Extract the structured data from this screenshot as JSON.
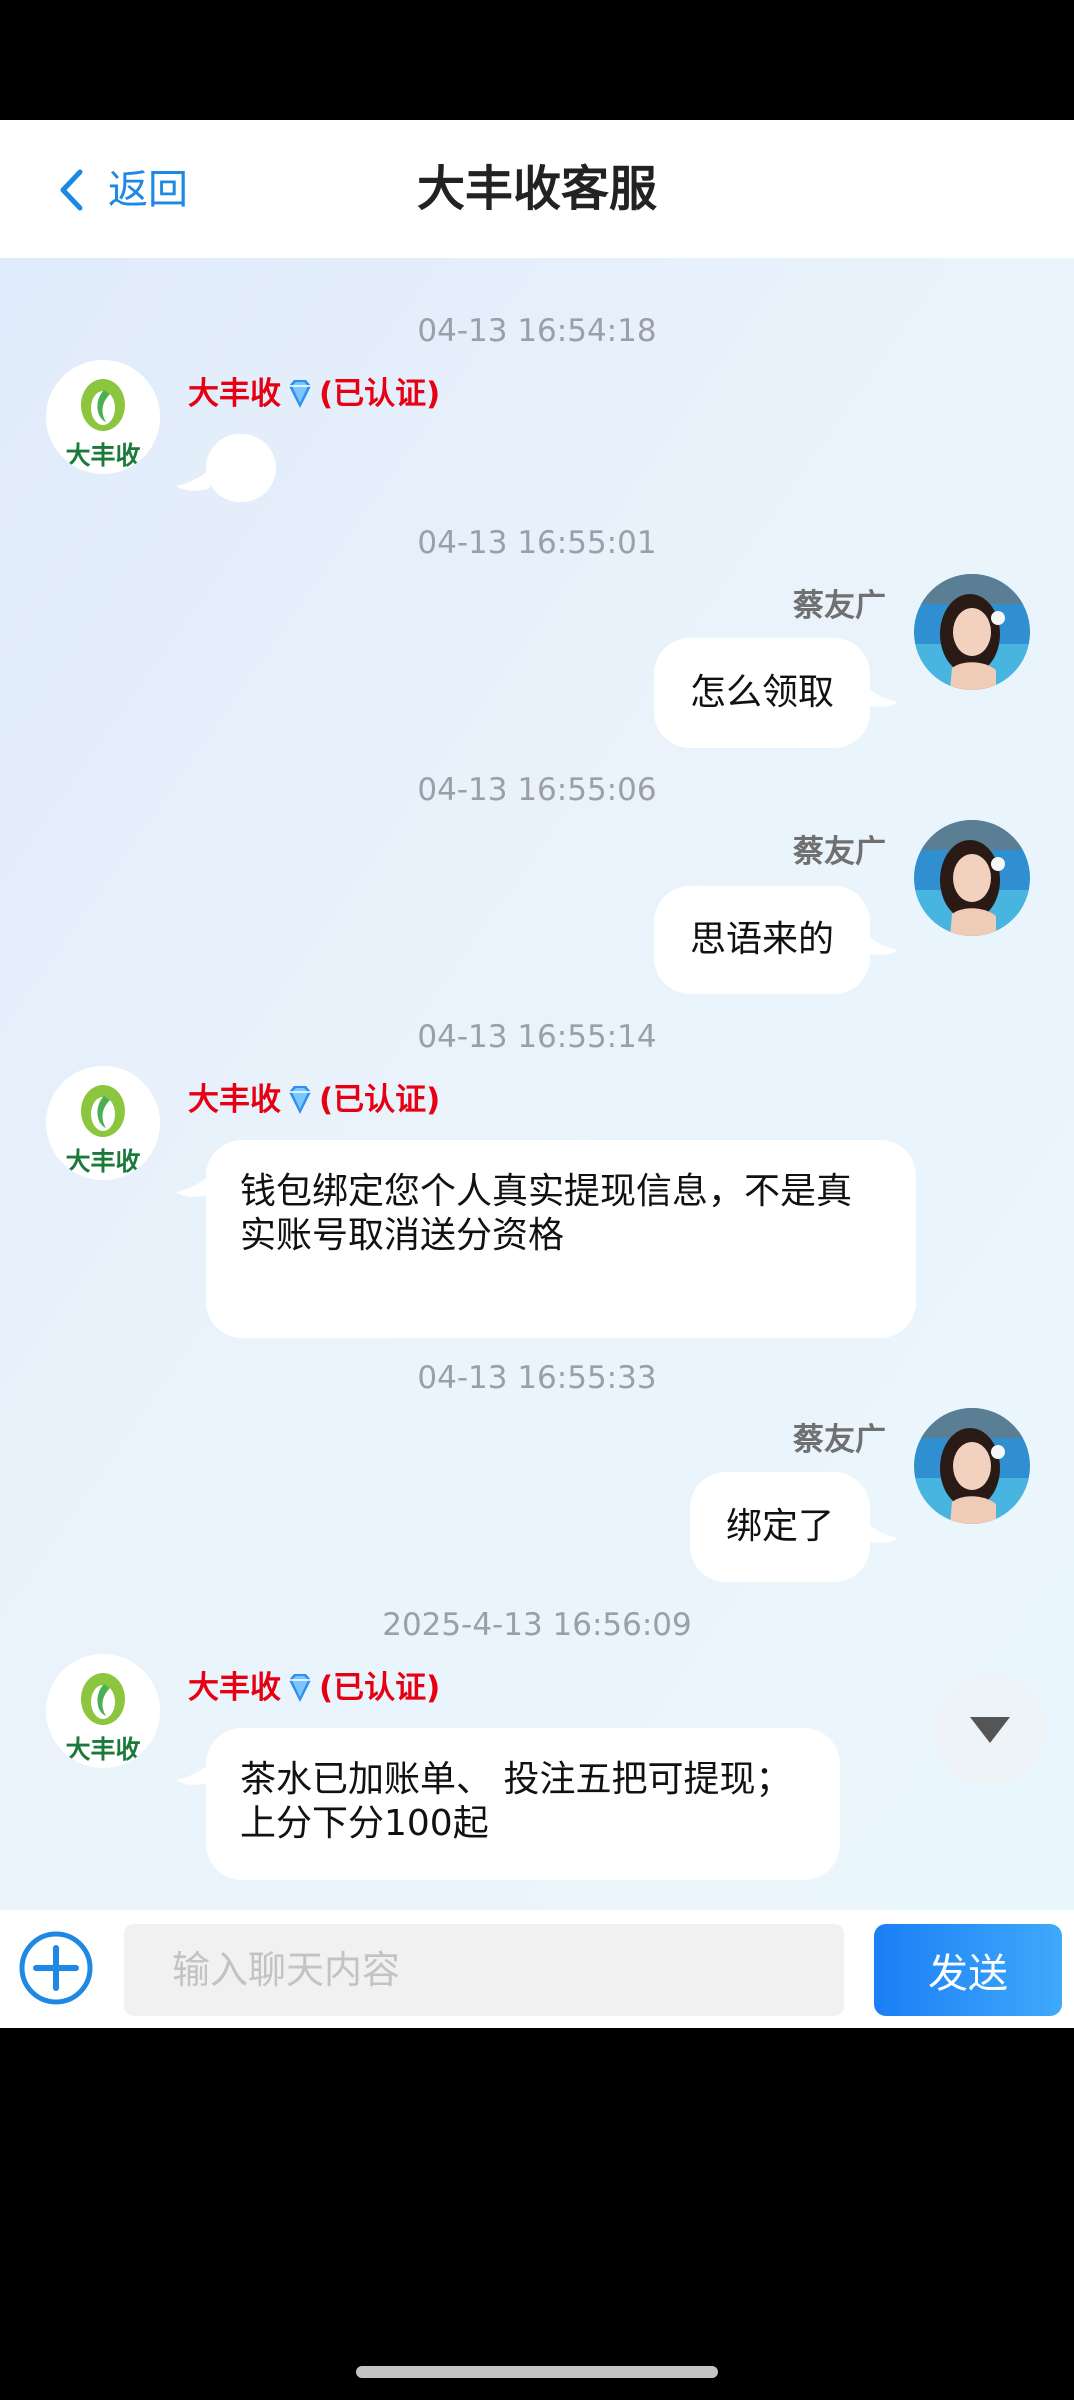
{
  "header": {
    "back_label": "返回",
    "title": "大丰收客服"
  },
  "bot": {
    "name": "大丰收",
    "verified": "(已认证)",
    "logo_text": "大丰收"
  },
  "user": {
    "name": "蔡友广"
  },
  "messages": [
    {
      "time": "04-13 16:54:18",
      "sender": "bot",
      "text": ""
    },
    {
      "time": "04-13 16:55:01",
      "sender": "user",
      "text": "怎么领取"
    },
    {
      "time": "04-13 16:55:06",
      "sender": "user",
      "text": "思语来的"
    },
    {
      "time": "04-13 16:55:14",
      "sender": "bot",
      "text": "钱包绑定您个人真实提现信息，不是真实账号取消送分资格"
    },
    {
      "time": "04-13 16:55:33",
      "sender": "user",
      "text": "绑定了"
    },
    {
      "time": "2025-4-13 16:56:09",
      "sender": "bot",
      "text": "茶水已加账单、 投注五把可提现；上分下分100起"
    }
  ],
  "input": {
    "placeholder": "输入聊天内容",
    "value": "",
    "send_label": "发送"
  },
  "icons": {
    "back": "chevron-left-icon",
    "verified": "diamond-icon",
    "plus": "plus-circle-icon",
    "scroll": "triangle-down-icon"
  },
  "colors": {
    "accent": "#1e88e5",
    "verified_red": "#e60012",
    "send_gradient_start": "#1a7ff5",
    "send_gradient_end": "#3fa9fb"
  }
}
